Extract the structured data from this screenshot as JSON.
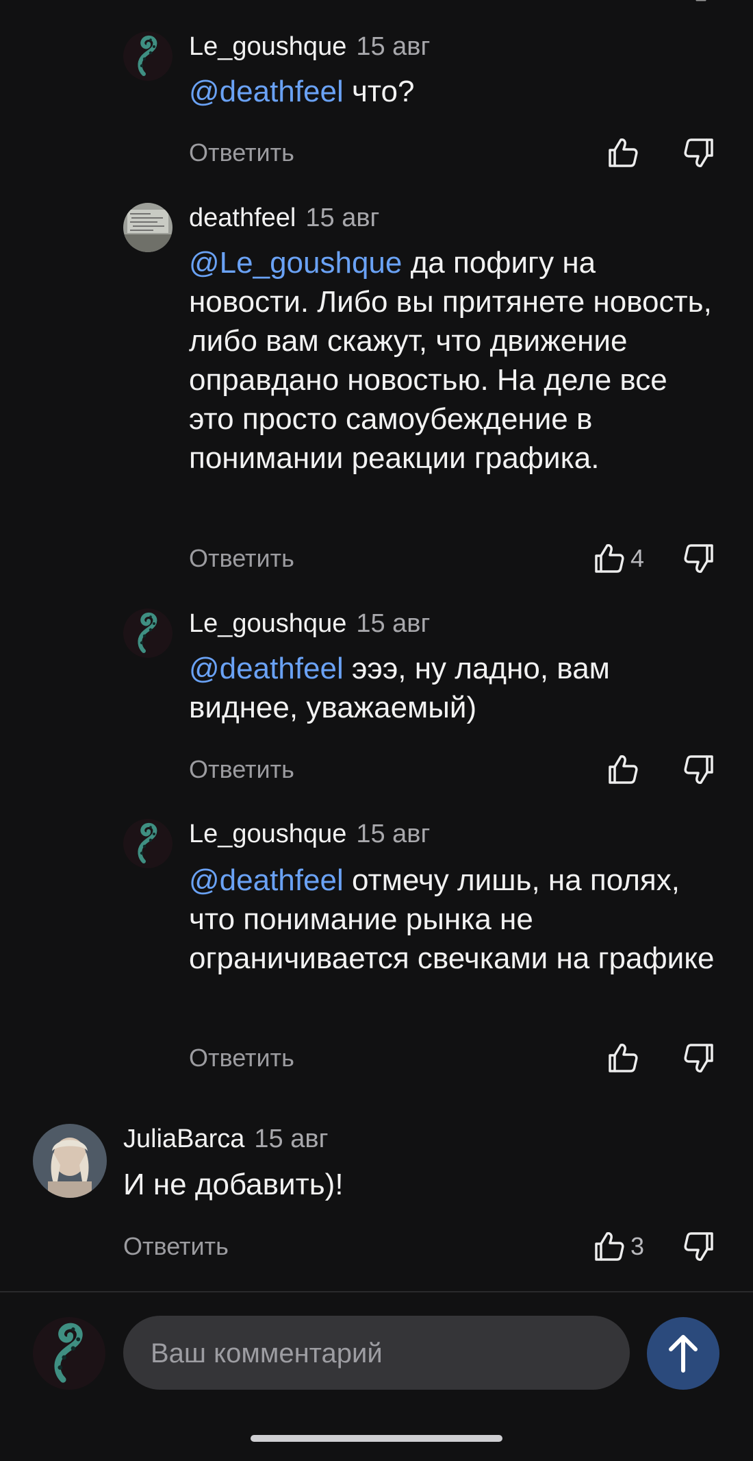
{
  "comments": [
    {
      "author": "Le_goushque",
      "date": "15 авг",
      "mention": "@deathfeel",
      "text": " что?",
      "reply_label": "Ответить",
      "likes": ""
    },
    {
      "author": "deathfeel",
      "date": "15 авг",
      "mention": "@Le_goushque",
      "text": " да пофигу на новости. Либо вы притянете новость, либо вам скажут, что движение оправдано новостью. На деле все это просто самоубеждение в понимании реакции графика.",
      "reply_label": "Ответить",
      "likes": "4"
    },
    {
      "author": "Le_goushque",
      "date": "15 авг",
      "mention": "@deathfeel",
      "text": " эээ, ну ладно, вам виднее, уважаемый)",
      "reply_label": "Ответить",
      "likes": ""
    },
    {
      "author": "Le_goushque",
      "date": "15 авг",
      "mention": "@deathfeel",
      "text": " отмечу лишь, на полях, что понимание рынка не ограничивается свечками на графике",
      "reply_label": "Ответить",
      "likes": ""
    },
    {
      "author": "JuliaBarca",
      "date": "15 авг",
      "mention": "",
      "text": "И не добавить)!",
      "reply_label": "Ответить",
      "likes": "3"
    }
  ],
  "composer": {
    "placeholder": "Ваш комментарий"
  },
  "icons": {
    "like": "thumb-up-icon",
    "dislike": "thumb-down-icon",
    "send": "arrow-up-icon"
  },
  "colors": {
    "background": "#111112",
    "mention": "#6aa2f5",
    "send_button": "#2b4a7c",
    "input_bg": "#353538"
  }
}
